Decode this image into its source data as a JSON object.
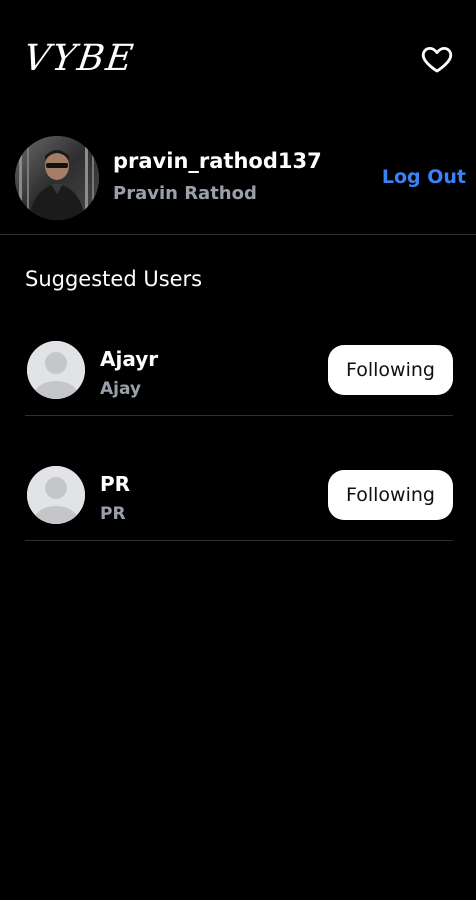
{
  "header": {
    "logo_text": "VYBE",
    "icons": {
      "heart": "heart-outline-icon"
    }
  },
  "profile": {
    "username": "pravin_rathod137",
    "full_name": "Pravin Rathod",
    "logout_label": "Log Out",
    "avatar": "profile-photo"
  },
  "suggested": {
    "title": "Suggested Users",
    "users": [
      {
        "username": "Ajayr",
        "full_name": "Ajay",
        "button_label": "Following",
        "avatar": "default-avatar-icon"
      },
      {
        "username": "PR",
        "full_name": "PR",
        "button_label": "Following",
        "avatar": "default-avatar-icon"
      }
    ]
  },
  "colors": {
    "background": "#000000",
    "text_primary": "#ffffff",
    "text_secondary": "#9aa0ab",
    "accent_link": "#3b82f6",
    "divider": "#2a2f3a",
    "button_bg": "#ffffff",
    "avatar_placeholder": "#e2e3e6"
  }
}
